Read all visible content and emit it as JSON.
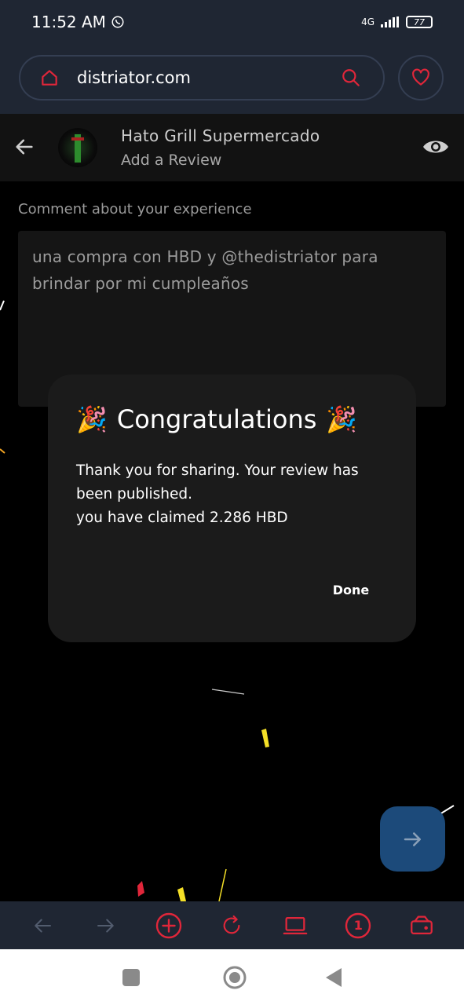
{
  "status_bar": {
    "time": "11:52 AM",
    "network": "4G",
    "battery": "77"
  },
  "browser": {
    "url": "distriator.com"
  },
  "review_header": {
    "business_name": "Hato Grill Supermercado",
    "subtitle": "Add a Review"
  },
  "form": {
    "comment_label": "Comment about your experience",
    "comment_value": "una compra con HBD y @thedistriator para brindar por mi cumpleaños"
  },
  "dialog": {
    "emoji": "🎉",
    "title": "Congratulations",
    "message_line1": "Thank you for sharing. Your review has been published.",
    "message_line2": "you have claimed 2.286 HBD",
    "done_label": "Done"
  },
  "toolbar": {
    "tabs_count": "1"
  },
  "colors": {
    "accent_red": "#e0263a",
    "bar_bg": "#1f2633",
    "fab_blue": "#1c4a7a",
    "dialog_bg": "#1b1b1b"
  }
}
